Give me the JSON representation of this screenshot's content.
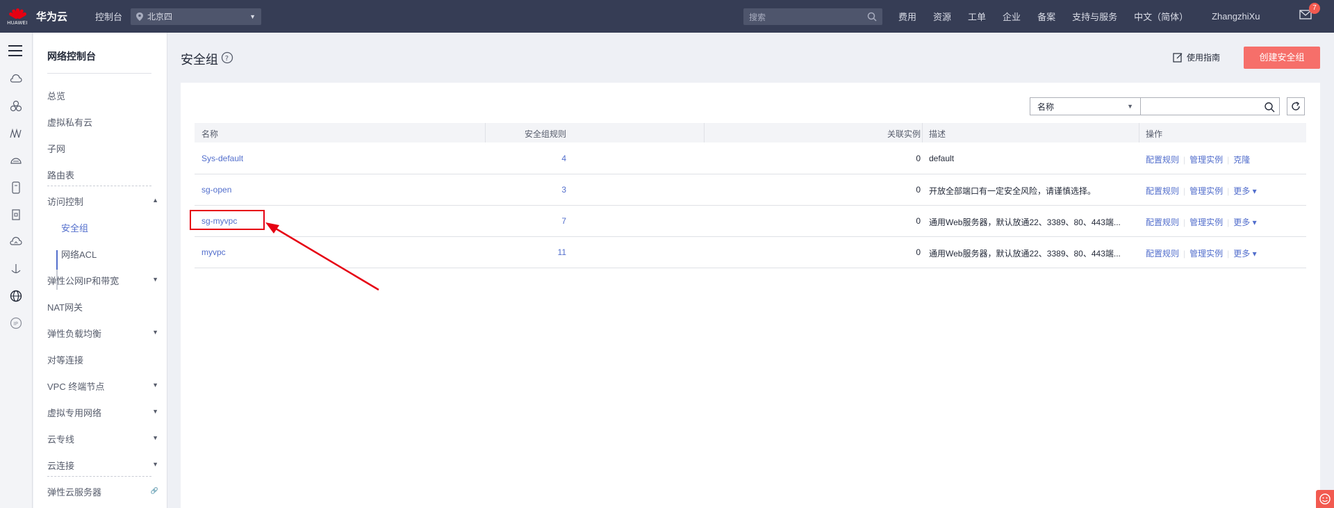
{
  "topbar": {
    "logo_text": "HUAWEI",
    "brand": "华为云",
    "console": "控制台",
    "region": "北京四",
    "search_placeholder": "搜索",
    "nav": [
      "费用",
      "资源",
      "工单",
      "企业",
      "备案",
      "支持与服务",
      "中文（简体）",
      "ZhangzhiXu"
    ],
    "mail_count": "7"
  },
  "rail_icons": [
    "menu-icon",
    "cloud-icon",
    "cluster-icon",
    "bridge-icon",
    "router-icon",
    "server-icon",
    "doc-icon",
    "cloud-link-icon",
    "anchor-icon",
    "globe-icon",
    "ip-icon"
  ],
  "sidebar": {
    "title": "网络控制台",
    "items": [
      {
        "label": "总览"
      },
      {
        "label": "虚拟私有云"
      },
      {
        "label": "子网"
      },
      {
        "label": "路由表"
      },
      {
        "label": "访问控制"
      },
      {
        "label": "安全组"
      },
      {
        "label": "网络ACL"
      },
      {
        "label": "弹性公网IP和带宽"
      },
      {
        "label": "NAT网关"
      },
      {
        "label": "弹性负载均衡"
      },
      {
        "label": "对等连接"
      },
      {
        "label": "VPC 终端节点"
      },
      {
        "label": "虚拟专用网络"
      },
      {
        "label": "云专线"
      },
      {
        "label": "云连接"
      },
      {
        "label": "弹性云服务器"
      }
    ]
  },
  "page": {
    "title": "安全组",
    "guide": "使用指南",
    "create_button": "创建安全组",
    "filter_select": "名称"
  },
  "table": {
    "columns": [
      "名称",
      "安全组规则",
      "关联实例",
      "描述",
      "操作"
    ],
    "rows": [
      {
        "name": "Sys-default",
        "rules": "4",
        "instances": "0",
        "desc": "default",
        "ops": [
          "配置规则",
          "管理实例",
          "克隆"
        ]
      },
      {
        "name": "sg-open",
        "rules": "3",
        "instances": "0",
        "desc": "开放全部端口有一定安全风险，请谨慎选择。",
        "ops": [
          "配置规则",
          "管理实例",
          "更多 ▾"
        ]
      },
      {
        "name": "sg-myvpc",
        "rules": "7",
        "instances": "0",
        "desc": "通用Web服务器，默认放通22、3389、80、443端...",
        "ops": [
          "配置规则",
          "管理实例",
          "更多 ▾"
        ]
      },
      {
        "name": "myvpc",
        "rules": "11",
        "instances": "0",
        "desc": "通用Web服务器，默认放通22、3389、80、443端...",
        "ops": [
          "配置规则",
          "管理实例",
          "更多 ▾"
        ]
      }
    ]
  },
  "colors": {
    "topbar": "#363d55",
    "accent": "#526ecc",
    "create_button": "#f66f6a",
    "highlight": "#e60012"
  }
}
